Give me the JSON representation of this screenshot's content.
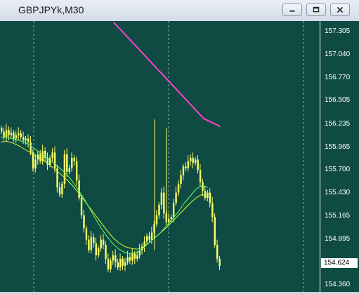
{
  "window": {
    "title": "GBPJPYk,M30",
    "buttons": [
      "minimize",
      "restore",
      "close"
    ]
  },
  "colors": {
    "background": "#0f4a43",
    "candles": "#ffff66",
    "ma_fast": "#66ff66",
    "ma_slow": "#ccff33",
    "trend_line": "#ff44cc",
    "grid": "#c8d6c8",
    "axis_text": "#ffffff"
  },
  "axis": {
    "ticks": [
      "157.305",
      "157.040",
      "156.770",
      "156.505",
      "156.235",
      "155.965",
      "155.700",
      "155.430",
      "155.165",
      "154.895",
      "154.360"
    ],
    "current_price": "154.624"
  },
  "chart_data": {
    "type": "candlestick",
    "ylim": [
      154.32,
      157.43
    ],
    "grid": true,
    "closes": [
      156.16,
      156.1,
      156.18,
      156.12,
      156.15,
      156.08,
      156.12,
      156.14,
      156.1,
      156.06,
      156.08,
      156.04,
      155.92,
      155.74,
      155.84,
      155.9,
      155.82,
      155.94,
      155.86,
      155.78,
      155.86,
      155.92,
      155.74,
      155.52,
      155.44,
      155.56,
      155.9,
      155.7,
      155.74,
      155.86,
      155.82,
      155.6,
      155.4,
      155.2,
      155.05,
      154.92,
      154.8,
      154.95,
      154.88,
      154.74,
      154.82,
      154.92,
      154.86,
      154.7,
      154.58,
      154.68,
      154.74,
      154.66,
      154.6,
      154.7,
      154.62,
      154.66,
      154.72,
      154.68,
      154.76,
      154.7,
      154.74,
      154.8,
      154.84,
      154.9,
      154.96,
      154.92,
      155.0,
      155.1,
      155.2,
      155.32,
      155.46,
      155.22,
      155.12,
      155.16,
      155.18,
      155.34,
      155.46,
      155.56,
      155.66,
      155.76,
      155.74,
      155.82,
      155.86,
      155.8,
      155.84,
      155.72,
      155.58,
      155.48,
      155.4,
      155.46,
      155.34,
      155.18,
      154.86,
      154.7,
      154.62
    ],
    "ma_fast": [
      156.1,
      156.09,
      156.08,
      156.06,
      156.04,
      156.0,
      155.95,
      155.9,
      155.85,
      155.8,
      155.74,
      155.68,
      155.6,
      155.5,
      155.4,
      155.28,
      155.16,
      155.05,
      154.95,
      154.87,
      154.81,
      154.77,
      154.76,
      154.77,
      154.82,
      154.88,
      154.94,
      155.0,
      155.08,
      155.16,
      155.24,
      155.34,
      155.42,
      155.5,
      155.54,
      155.52
    ],
    "ma_slow": [
      156.04,
      156.05,
      156.03,
      156.0,
      155.96,
      155.92,
      155.88,
      155.84,
      155.79,
      155.74,
      155.68,
      155.62,
      155.55,
      155.47,
      155.38,
      155.29,
      155.2,
      155.11,
      155.02,
      154.94,
      154.88,
      154.84,
      154.82,
      154.81,
      154.83,
      154.88,
      154.94,
      155.0,
      155.06,
      155.13,
      155.2,
      155.27,
      155.34,
      155.4,
      155.44,
      155.4
    ]
  }
}
